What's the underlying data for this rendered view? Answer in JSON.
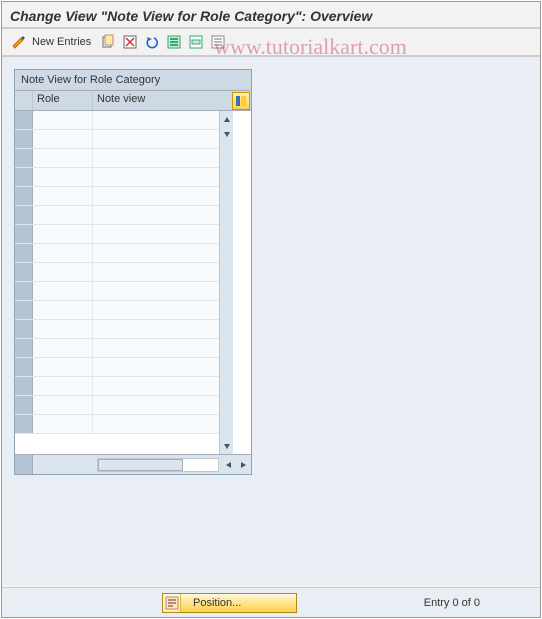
{
  "title": "Change View \"Note View for Role Category\": Overview",
  "watermark": "www.tutorialkart.com",
  "toolbar": {
    "new_entries": "New Entries"
  },
  "panel": {
    "title": "Note View for Role Category",
    "col_role": "Role",
    "col_note": "Note view",
    "row_count": 17
  },
  "footer": {
    "position_label": "Position...",
    "entry_text": "Entry 0 of 0"
  }
}
